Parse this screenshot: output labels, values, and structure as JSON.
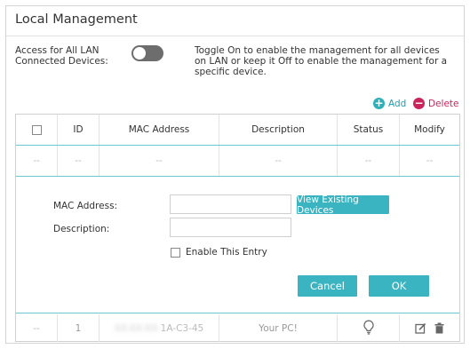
{
  "panel": {
    "title": "Local Management"
  },
  "access": {
    "label": "Access for All LAN Connected Devices:",
    "toggle_state": "off",
    "help": "Toggle On to enable the management for all devices on LAN or keep it Off to enable the management for a specific device."
  },
  "actions": {
    "add": "Add",
    "delete": "Delete"
  },
  "table": {
    "headers": [
      "ID",
      "MAC Address",
      "Description",
      "Status",
      "Modify"
    ],
    "placeholder_row": [
      "--",
      "--",
      "--",
      "--",
      "--",
      "--"
    ],
    "pc_row": {
      "checkbox": "--",
      "id": "1",
      "mac_hidden": "XX-XX-XX-",
      "mac_visible": "1A-C3-45",
      "description": "Your PC!",
      "status_icon": "lightbulb-icon",
      "modify_icons": [
        "edit-icon",
        "trash-icon"
      ]
    }
  },
  "form": {
    "mac_label": "MAC Address:",
    "mac_value": "",
    "description_label": "Description:",
    "description_value": "",
    "view_devices": "View Existing Devices",
    "enable_entry": "Enable This Entry",
    "enable_checked": false,
    "cancel": "Cancel",
    "ok": "OK"
  },
  "colors": {
    "accent": "#3ab4c1",
    "delete": "#c9245c",
    "toggle_off": "#6d6d6d"
  }
}
